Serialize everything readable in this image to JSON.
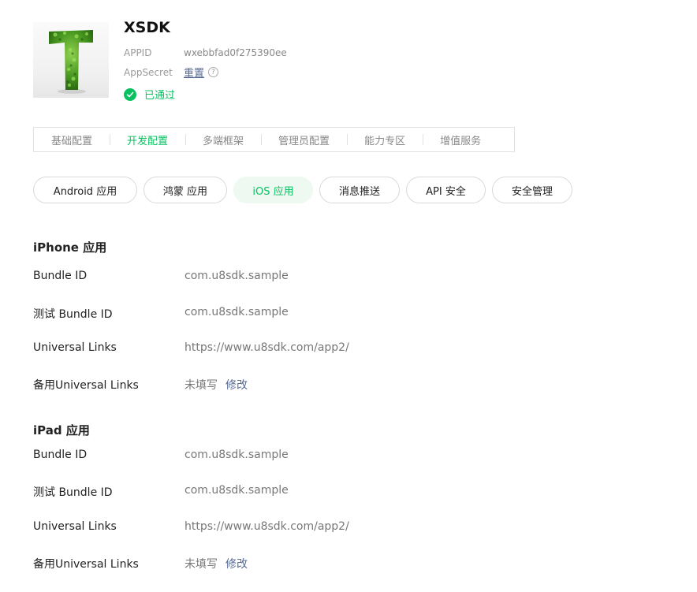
{
  "app": {
    "name": "XSDK",
    "appid_label": "APPID",
    "appid_value": "wxebbfad0f275390ee",
    "secret_label": "AppSecret",
    "reset_label": "重置",
    "help_icon": "?",
    "status_text": "已通过",
    "logo_icon": "leaf-letter-t-logo",
    "status_icon": "check-circle-icon",
    "accent_color": "#07c160",
    "link_color": "#576b95"
  },
  "top_tabs": [
    {
      "label": "基础配置",
      "active": false
    },
    {
      "label": "开发配置",
      "active": true
    },
    {
      "label": "多端框架",
      "active": false
    },
    {
      "label": "管理员配置",
      "active": false
    },
    {
      "label": "能力专区",
      "active": false
    },
    {
      "label": "增值服务",
      "active": false
    }
  ],
  "platform_tabs": [
    {
      "label": "Android 应用",
      "active": false
    },
    {
      "label": "鸿蒙 应用",
      "active": false
    },
    {
      "label": "iOS 应用",
      "active": true
    },
    {
      "label": "消息推送",
      "active": false
    },
    {
      "label": "API 安全",
      "active": false
    },
    {
      "label": "安全管理",
      "active": false
    }
  ],
  "iphone": {
    "title": "iPhone 应用",
    "rows": [
      {
        "label": "Bundle ID",
        "value": "com.u8sdk.sample"
      },
      {
        "label": "测试 Bundle ID",
        "value": "com.u8sdk.sample"
      },
      {
        "label": "Universal Links",
        "value": "https://www.u8sdk.com/app2/"
      },
      {
        "label": "备用Universal Links",
        "value": "未填写",
        "edit": "修改"
      }
    ]
  },
  "ipad": {
    "title": "iPad 应用",
    "rows": [
      {
        "label": "Bundle ID",
        "value": "com.u8sdk.sample"
      },
      {
        "label": "测试 Bundle ID",
        "value": "com.u8sdk.sample"
      },
      {
        "label": "Universal Links",
        "value": "https://www.u8sdk.com/app2/"
      },
      {
        "label": "备用Universal Links",
        "value": "未填写",
        "edit": "修改"
      }
    ]
  }
}
